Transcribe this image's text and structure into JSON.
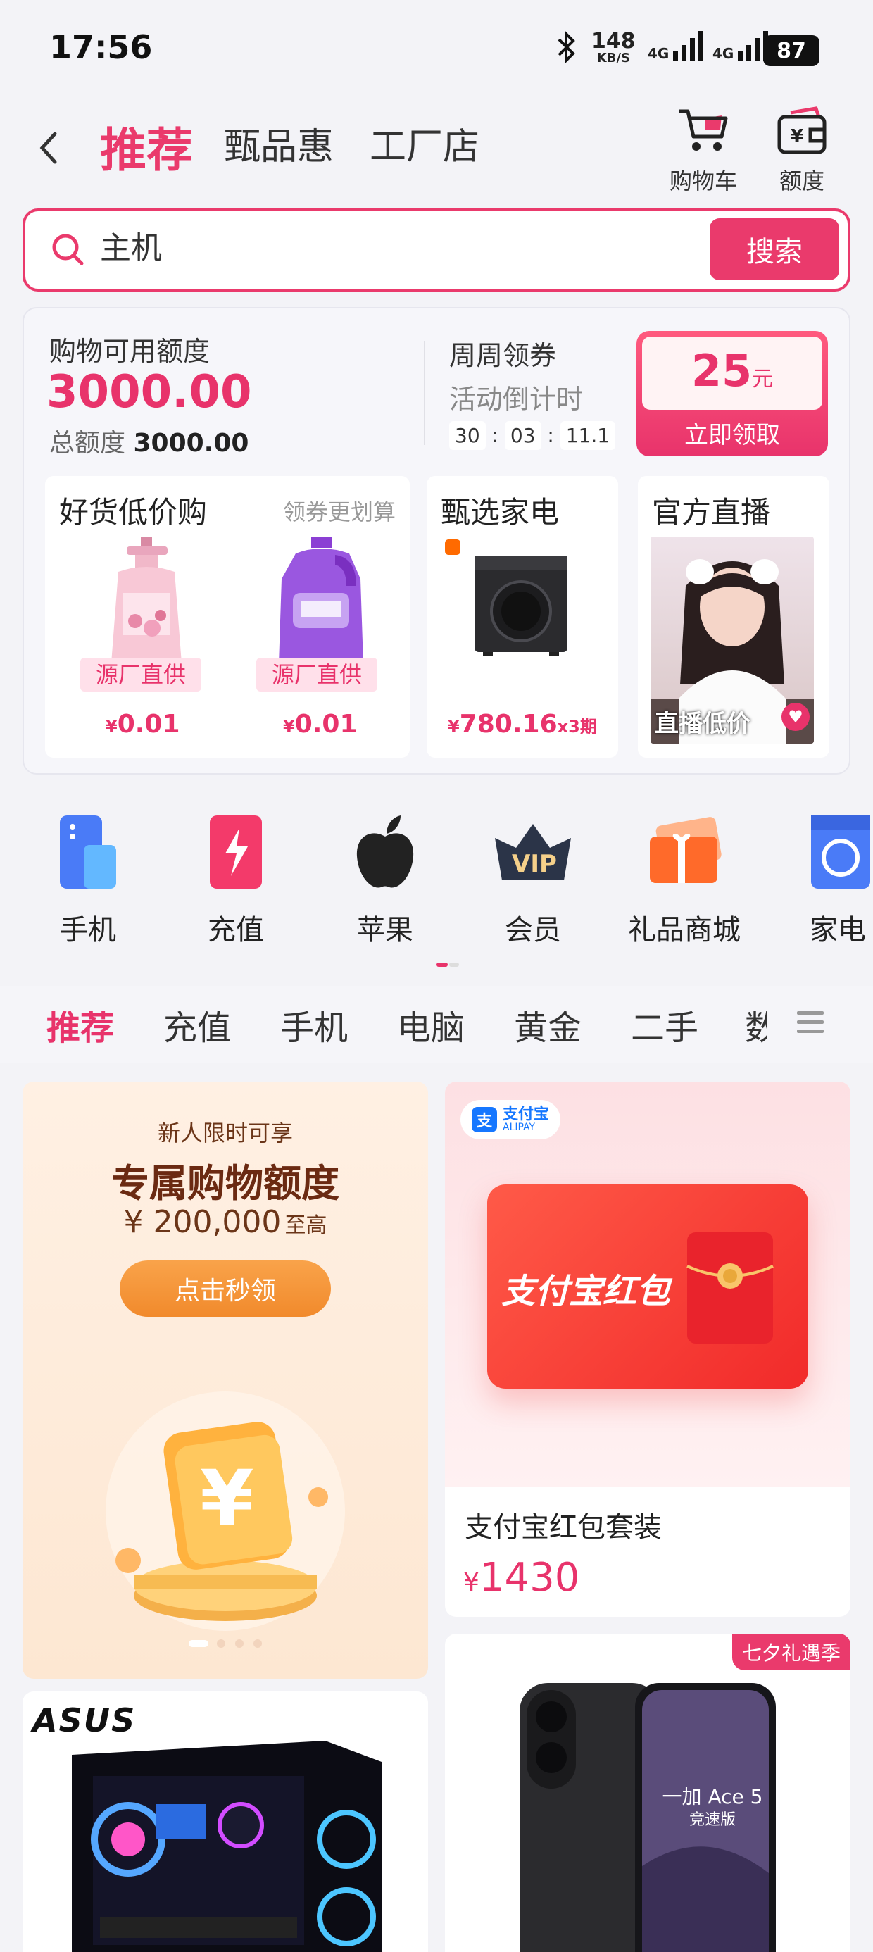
{
  "status_bar": {
    "time": "17:56",
    "net_speed": "148",
    "net_unit": "KB/S",
    "sig1": "4G",
    "sig2": "4G",
    "battery": "87"
  },
  "header": {
    "tabs": [
      "推荐",
      "甄品惠",
      "工厂店"
    ],
    "cart_label": "购物车",
    "quota_label": "额度"
  },
  "search": {
    "value": "主机",
    "button": "搜索"
  },
  "credit": {
    "label": "购物可用额度",
    "amount": "3000.00",
    "total_label": "总额度",
    "total_value": "3000.00"
  },
  "coupon": {
    "title": "周周领券",
    "subtitle": "活动倒计时",
    "countdown": [
      "30",
      "03",
      "11.1"
    ],
    "amount": "25",
    "unit": "元",
    "button": "立即领取"
  },
  "promo_cards": {
    "card1": {
      "title": "好货低价购",
      "subtitle": "领券更划算",
      "tag": "源厂直供",
      "prices": [
        "0.01",
        "0.01"
      ]
    },
    "card2": {
      "title": "甄选家电",
      "price": "780.16",
      "installment": "x3",
      "installment_unit": "期"
    },
    "card3": {
      "title": "官方直播",
      "overlay": "直播低价"
    }
  },
  "currency": "¥",
  "categories": [
    "手机",
    "充值",
    "苹果",
    "会员",
    "礼品商城",
    "家电"
  ],
  "category_tabs": [
    "推荐",
    "充值",
    "手机",
    "电脑",
    "黄金",
    "二手",
    "数"
  ],
  "feed": {
    "banner": {
      "line1": "新人限时可享",
      "headline": "专属购物额度",
      "amount": "¥ 200,000",
      "amount_suffix": "至高",
      "button": "点击秒领"
    },
    "alipay": {
      "logo": "支付宝",
      "logo_en": "ALIPAY",
      "card_text": "支付宝红包",
      "title": "支付宝红包套装",
      "price": "1430"
    },
    "asus": {
      "brand": "ASUS"
    },
    "phone": {
      "tag": "七夕礼遇季",
      "screen_text": "一加 Ace 5",
      "screen_sub": "竞速版"
    }
  },
  "colors": {
    "accent": "#e8336b",
    "orange": "#f39a3d"
  }
}
